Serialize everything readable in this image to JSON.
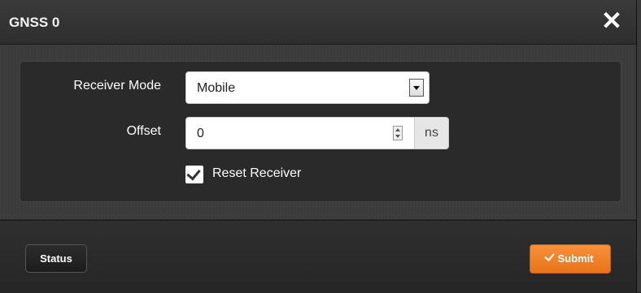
{
  "dialog": {
    "title": "GNSS 0",
    "close_glyph": "✕"
  },
  "form": {
    "receiver_mode": {
      "label": "Receiver Mode",
      "selected": "Mobile"
    },
    "offset": {
      "label": "Offset",
      "value": "0",
      "unit": "ns"
    },
    "reset_receiver": {
      "label": "Reset Receiver",
      "checked": true
    }
  },
  "footer": {
    "status_label": "Status",
    "submit_label": "Submit"
  },
  "colors": {
    "accent": "#f08428",
    "background": "#2b2b2b"
  },
  "icons": {
    "close": "close-icon",
    "dropdown": "chevron-down-icon",
    "spinner": "spinner-icon",
    "check": "check-icon"
  }
}
